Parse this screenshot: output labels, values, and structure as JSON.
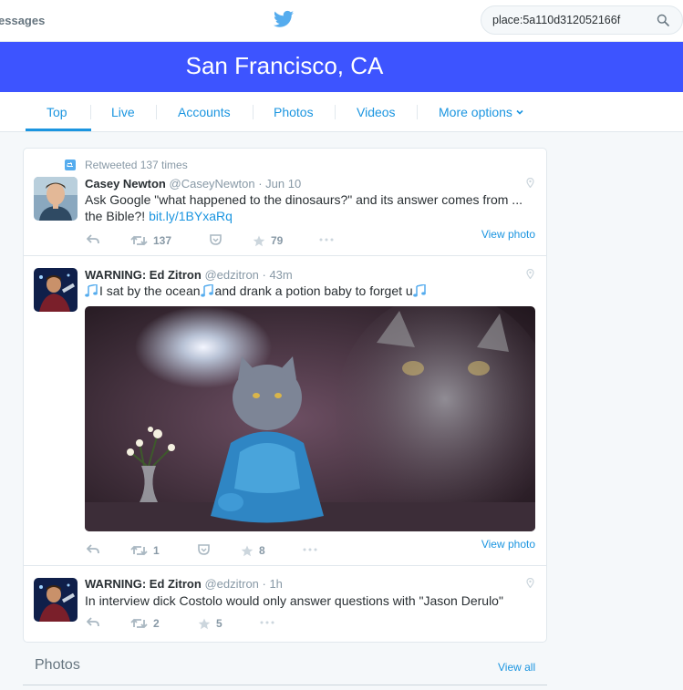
{
  "topbar": {
    "messages_label": "essages",
    "search_value": "place:5a110d312052166f"
  },
  "banner": {
    "title": "San Francisco, CA"
  },
  "tabs": [
    {
      "label": "Top"
    },
    {
      "label": "Live"
    },
    {
      "label": "Accounts"
    },
    {
      "label": "Photos"
    },
    {
      "label": "Videos"
    },
    {
      "label": "More options"
    }
  ],
  "tweets": [
    {
      "retweet_context": "Retweeted 137 times",
      "name": "Casey Newton",
      "meta": "@CaseyNewton · Jun 10",
      "text": "Ask Google \"what happened to the dinosaurs?\" and its answer comes from ... the Bible?!",
      "link": "bit.ly/1BYxaRq",
      "retweets": "137",
      "favorites": "79",
      "view_photo": "View photo"
    },
    {
      "name": "WARNING: Ed Zitron",
      "meta": "@edzitron · 43m",
      "text_a": "I sat by the ocean",
      "text_b": "and drank a potion baby to forget u",
      "retweets": "1",
      "favorites": "8",
      "view_photo": "View photo"
    },
    {
      "name": "WARNING: Ed Zitron",
      "meta": "@edzitron · 1h",
      "text": "In interview dick Costolo would only answer questions with \"Jason Derulo\"",
      "retweets": "2",
      "favorites": "5"
    }
  ],
  "photos_section": {
    "title": "Photos",
    "view_all": "View all"
  },
  "icons": {
    "brand": "twitter-bird-icon",
    "search": "magnifier-icon",
    "reply": "reply-arrow-icon",
    "retweet": "retweet-icon",
    "favorite": "star-icon",
    "more": "ellipsis-icon",
    "location": "map-pin-icon",
    "notes": "music-notes-icon"
  },
  "colors": {
    "accent": "#1b95e0",
    "banner": "#3d54ff",
    "bird": "#55acee"
  }
}
